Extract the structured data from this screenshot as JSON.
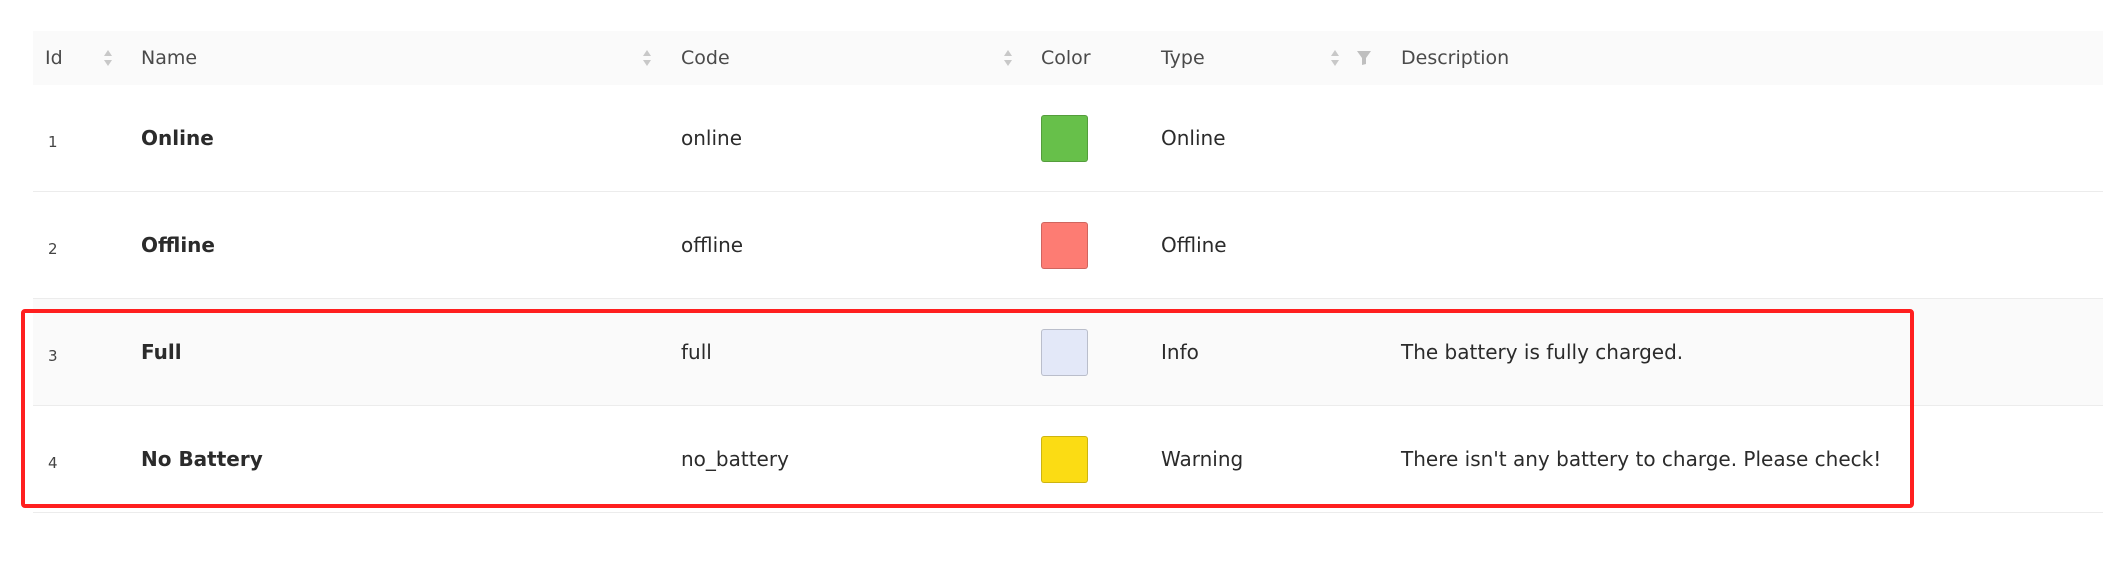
{
  "table": {
    "columns": {
      "id": "Id",
      "name": "Name",
      "code": "Code",
      "color": "Color",
      "type": "Type",
      "description": "Description"
    },
    "rows": [
      {
        "id": "1",
        "name": "Online",
        "code": "online",
        "color": "#67c04a",
        "type": "Online",
        "description": ""
      },
      {
        "id": "2",
        "name": "Offline",
        "code": "offline",
        "color": "#fd7c73",
        "type": "Offline",
        "description": ""
      },
      {
        "id": "3",
        "name": "Full",
        "code": "full",
        "color": "#e3e8f8",
        "type": "Info",
        "description": "The battery is fully charged."
      },
      {
        "id": "4",
        "name": "No Battery",
        "code": "no_battery",
        "color": "#fbdc14",
        "type": "Warning",
        "description": "There isn't any battery to charge. Please check!"
      }
    ]
  },
  "annotation": {
    "highlight_color": "#ff1f1f"
  }
}
